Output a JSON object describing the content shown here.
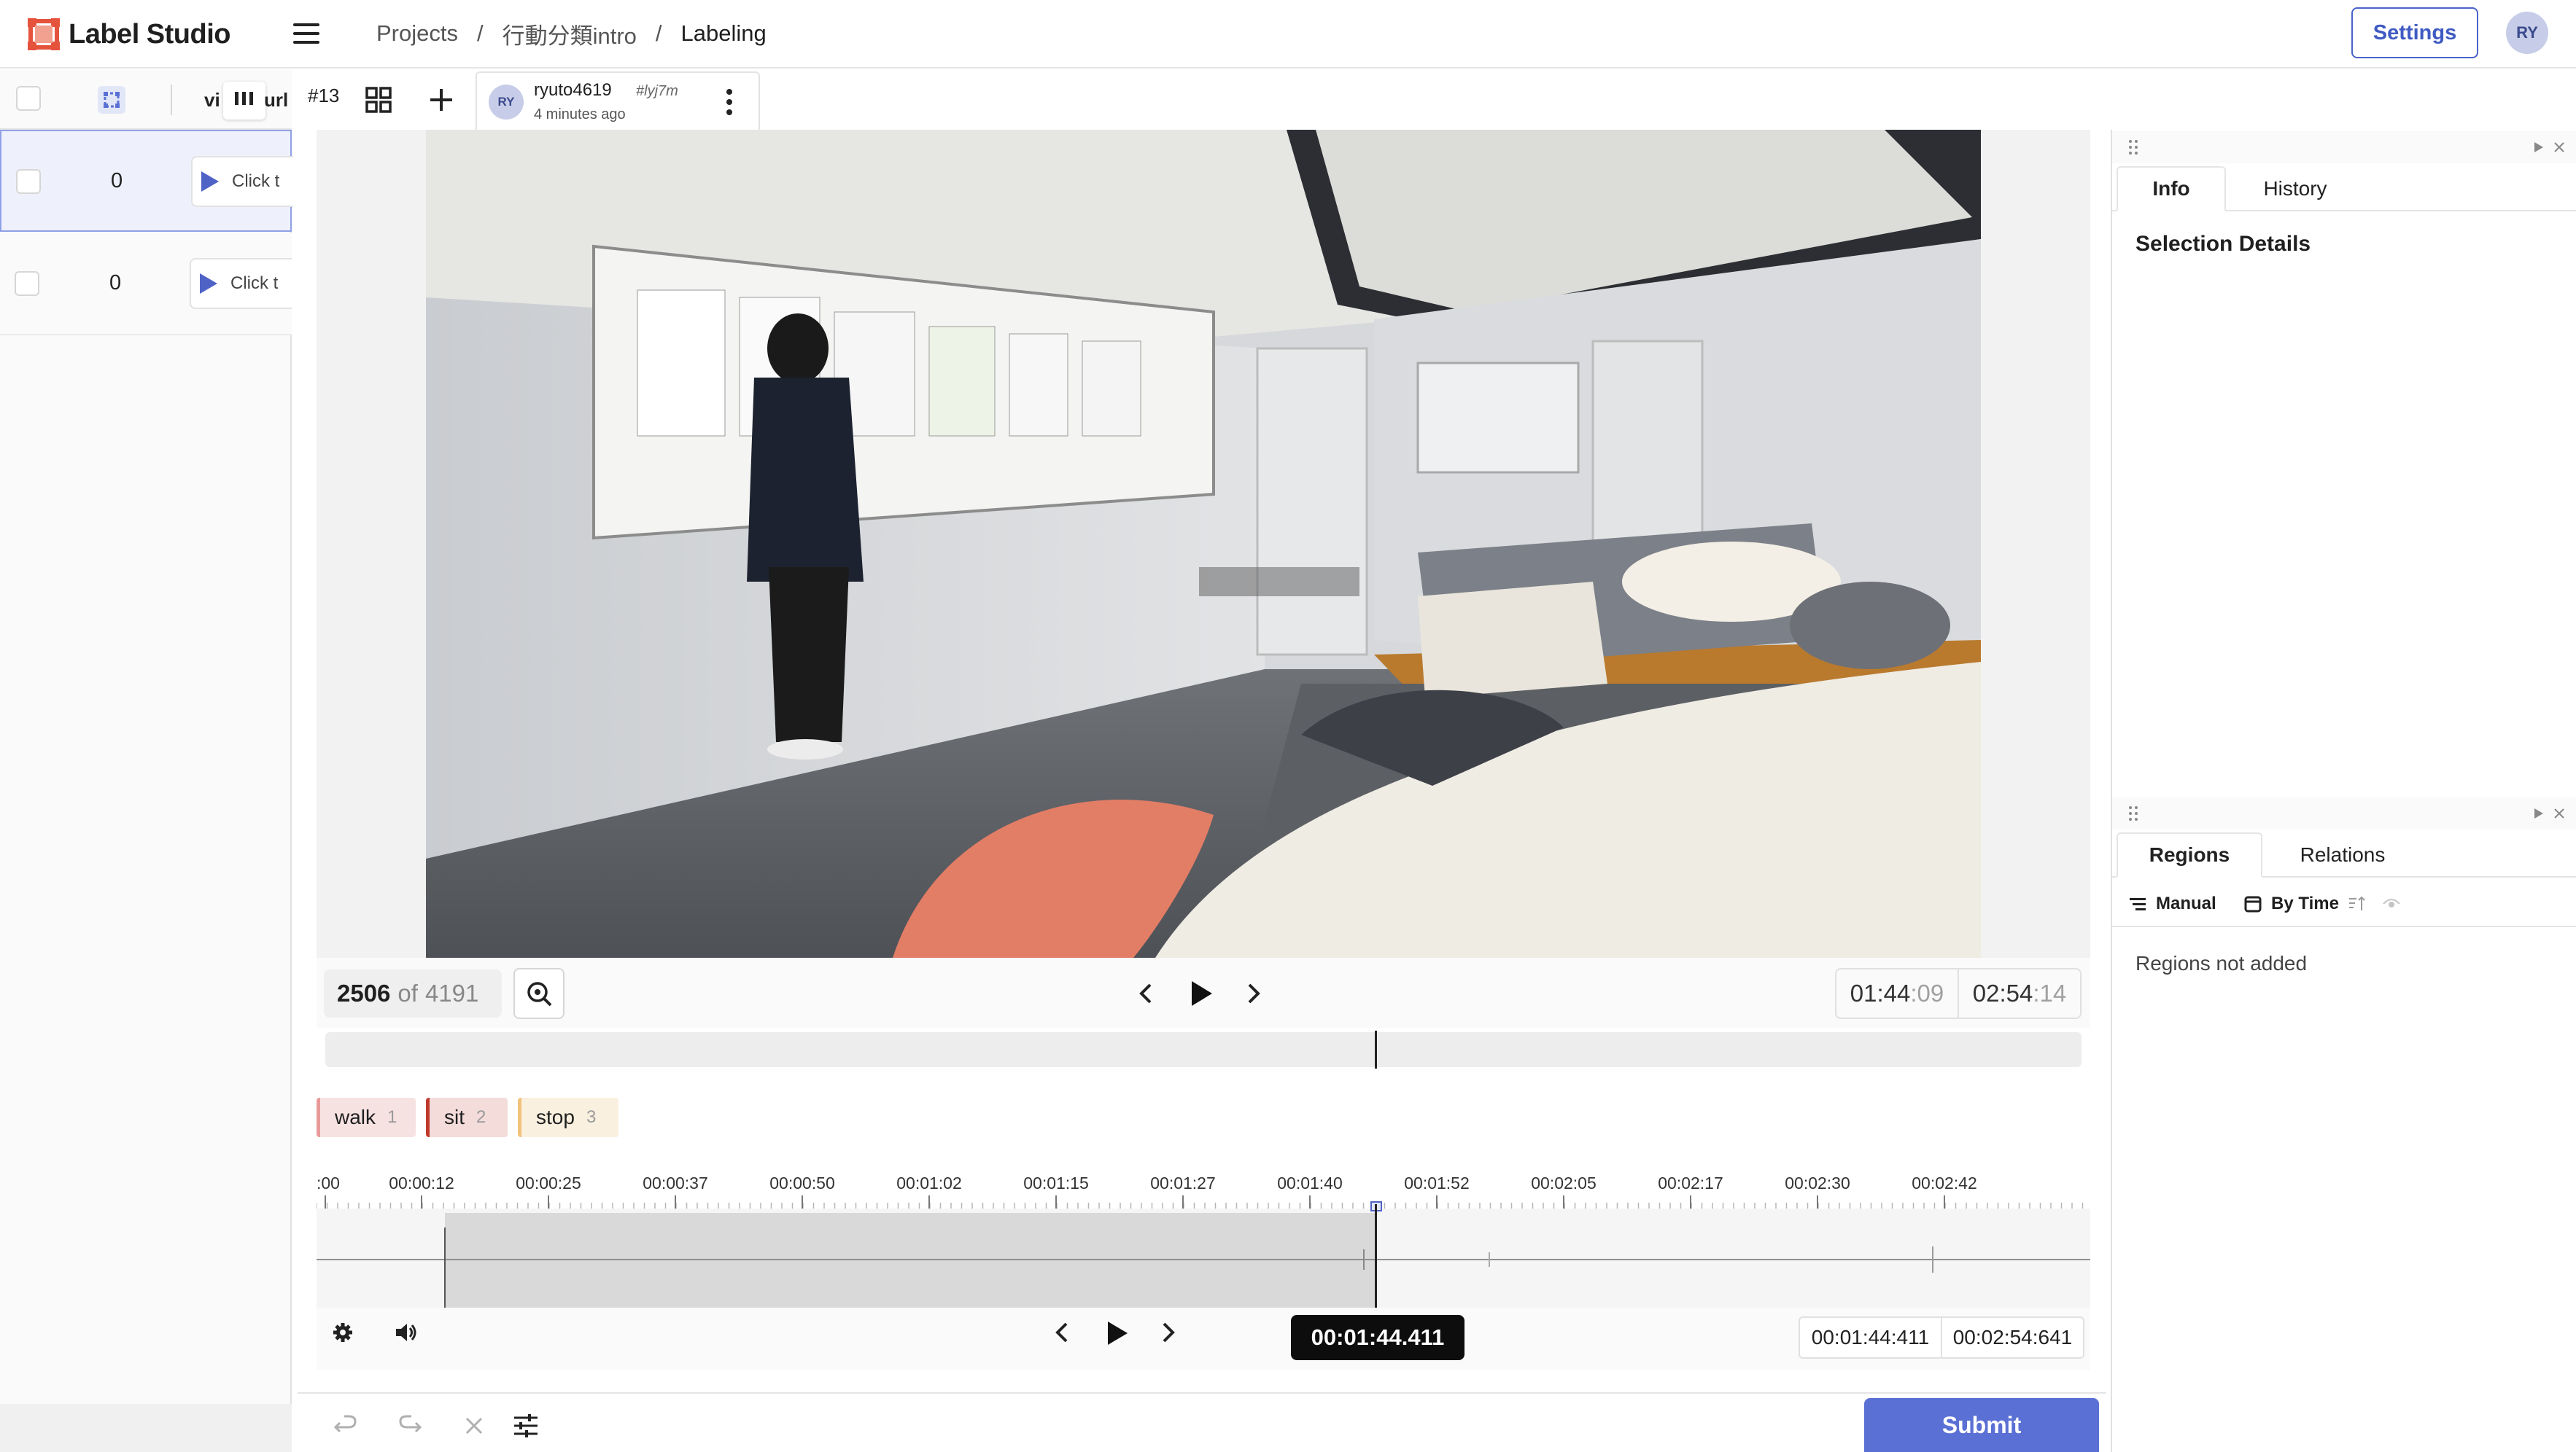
{
  "app": {
    "name": "Label Studio",
    "colors": {
      "accent": "#4a63c9",
      "submit": "#5a70d4",
      "logo": "#e5533d"
    }
  },
  "breadcrumb": {
    "projects": "Projects",
    "project": "行動分類intro",
    "current": "Labeling",
    "separator": "/"
  },
  "header": {
    "settings_label": "Settings",
    "avatar_initials": "RY"
  },
  "task_list": {
    "columns": {
      "video": "vi",
      "url": "url"
    },
    "rows": [
      {
        "count": "0",
        "cell": "Click t",
        "selected": true
      },
      {
        "count": "0",
        "cell": "Click t",
        "selected": false
      }
    ]
  },
  "toolbar": {
    "task_id": "#13"
  },
  "annotation": {
    "avatar": "RY",
    "user": "ryuto4619",
    "hash": "#lyj7m",
    "time": "4 minutes ago"
  },
  "player": {
    "frame_current": "2506",
    "frame_of": "of",
    "frame_total": "4191",
    "time_current": "01:44",
    "time_current_frac": ":09",
    "time_total": "02:54",
    "time_total_frac": ":14",
    "seek_position": 0.597
  },
  "labels": [
    {
      "name": "walk",
      "key": "1",
      "color": "#e89a9a"
    },
    {
      "name": "sit",
      "key": "2",
      "color": "#c0392b"
    },
    {
      "name": "stop",
      "key": "3",
      "color": "#f1c27a"
    }
  ],
  "timeline": {
    "ticks": [
      ":00",
      "00:00:12",
      "00:00:25",
      "00:00:37",
      "00:00:50",
      "00:01:02",
      "00:01:15",
      "00:01:27",
      "00:01:40",
      "00:01:52",
      "00:02:05",
      "00:02:17",
      "00:02:30",
      "00:02:42"
    ],
    "current": "00:01:44.411",
    "box_current": "00:01:44:411",
    "box_total": "00:02:54:641"
  },
  "footer": {
    "submit_label": "Submit"
  },
  "right_panel": {
    "tabs_top": [
      "Info",
      "History"
    ],
    "selection_details": "Selection Details",
    "tabs_bottom": [
      "Regions",
      "Relations"
    ],
    "sort_manual": "Manual",
    "sort_by_time": "By Time",
    "regions_empty": "Regions not added"
  }
}
